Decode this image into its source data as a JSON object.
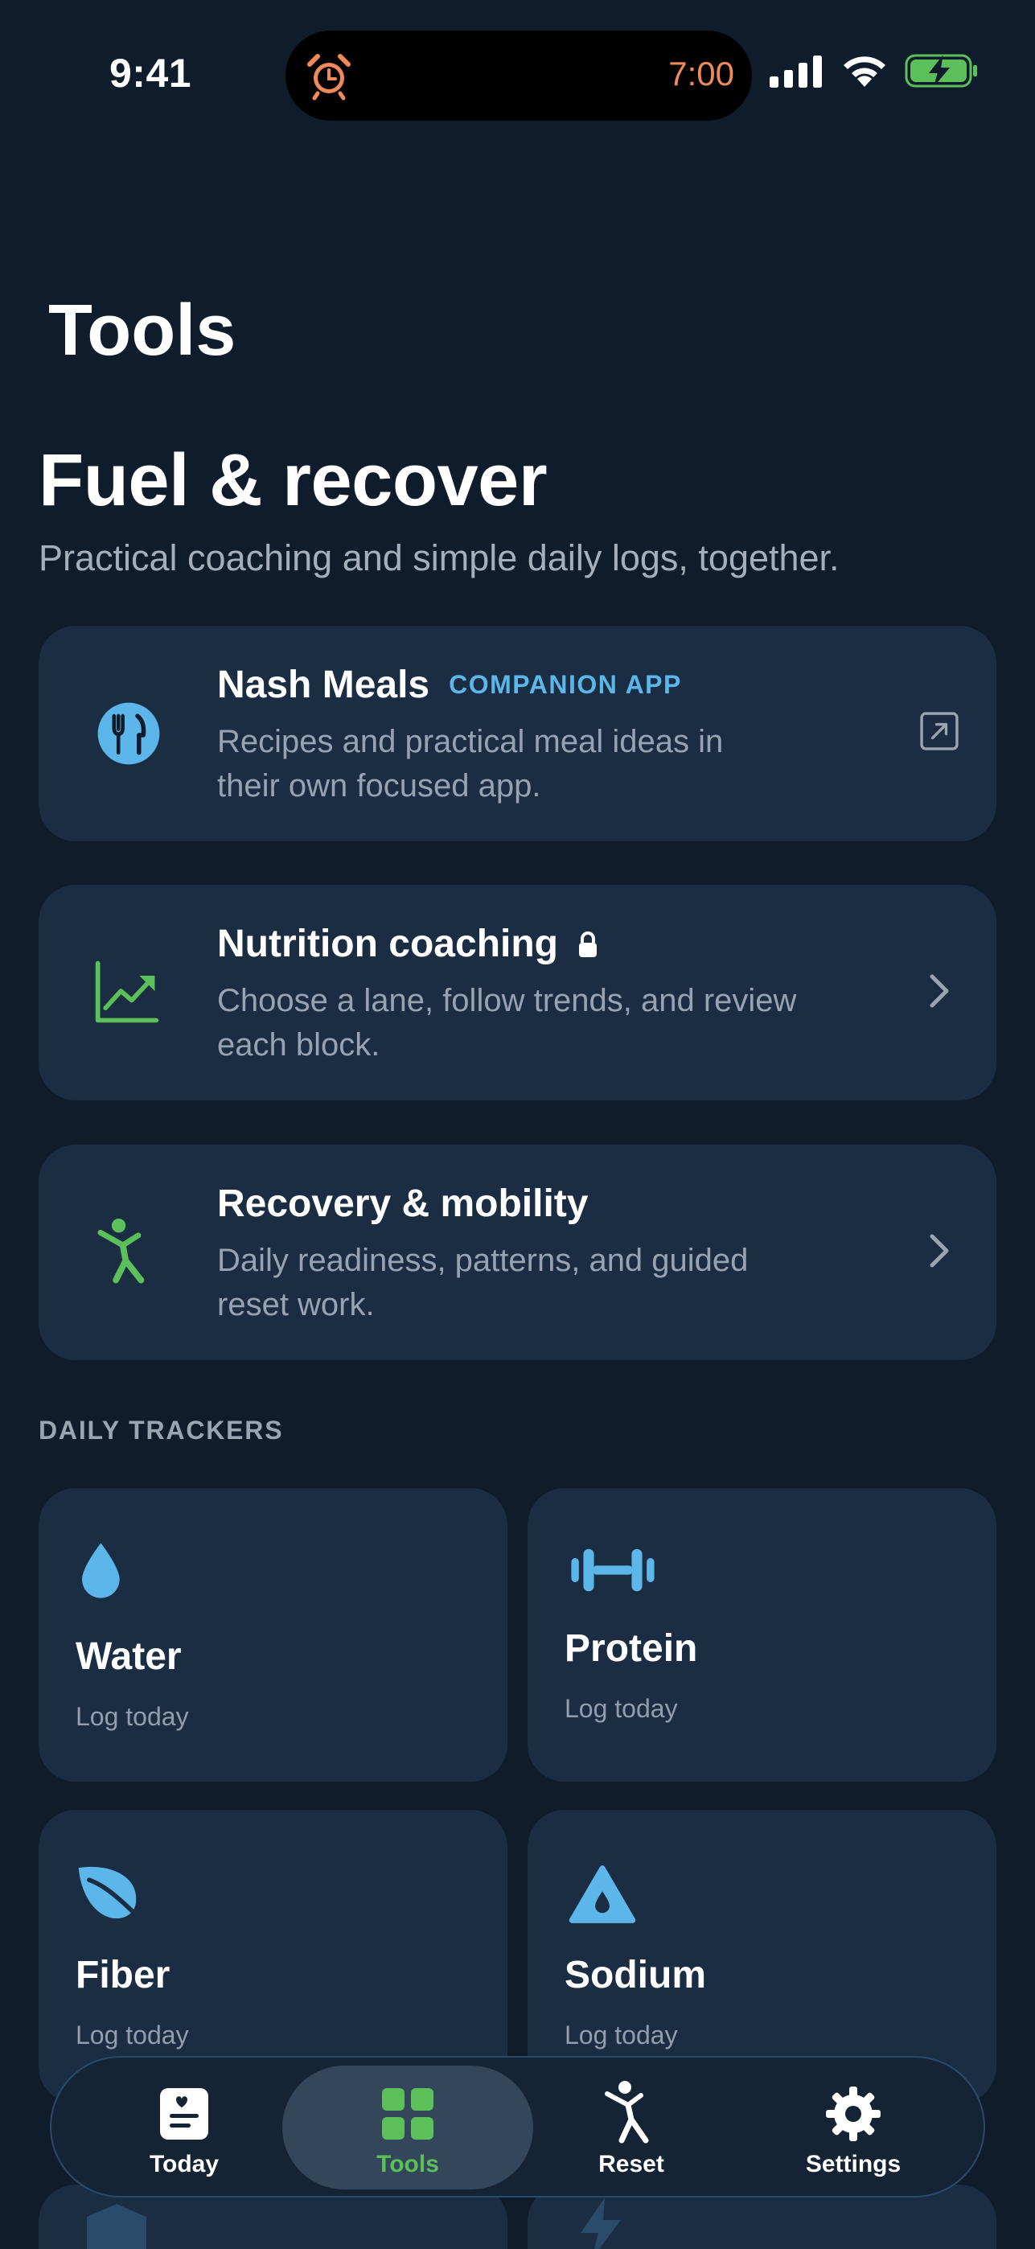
{
  "status_bar": {
    "time": "9:41",
    "island_time": "7:00"
  },
  "header": {
    "title": "Tools"
  },
  "hero": {
    "title": "Fuel & recover",
    "subtitle": "Practical coaching and simple daily logs, together."
  },
  "cards": [
    {
      "title": "Nash Meals",
      "badge": "COMPANION APP",
      "description": "Recipes and practical meal ideas in their own focused app.",
      "icon": "fork-knife-icon"
    },
    {
      "title": "Nutrition coaching",
      "description": "Choose a lane, follow trends, and review each block.",
      "icon": "chart-up-icon"
    },
    {
      "title": "Recovery & mobility",
      "description": "Daily readiness, patterns, and guided reset work.",
      "icon": "stretch-figure-icon"
    }
  ],
  "section": {
    "daily_trackers": "DAILY TRACKERS"
  },
  "trackers": [
    {
      "title": "Water",
      "subtitle": "Log today",
      "icon": "water-drop-icon"
    },
    {
      "title": "Protein",
      "subtitle": "Log today",
      "icon": "dumbbell-icon"
    },
    {
      "title": "Fiber",
      "subtitle": "Log today",
      "icon": "leaf-icon"
    },
    {
      "title": "Sodium",
      "subtitle": "Log today",
      "icon": "salt-triangle-icon"
    }
  ],
  "tab_bar": {
    "selected": "Tools",
    "tabs": [
      {
        "label": "Today",
        "icon": "journal-heart-icon"
      },
      {
        "label": "Tools",
        "icon": "grid-icon"
      },
      {
        "label": "Reset",
        "icon": "stretch-figure-icon"
      },
      {
        "label": "Settings",
        "icon": "gear-icon"
      }
    ]
  },
  "colors": {
    "background": "#0f1c2b",
    "card": "#1b2d42",
    "accent_blue": "#5cb6ea",
    "accent_green": "#5cc05a",
    "alarm_orange": "#f08a5a"
  }
}
